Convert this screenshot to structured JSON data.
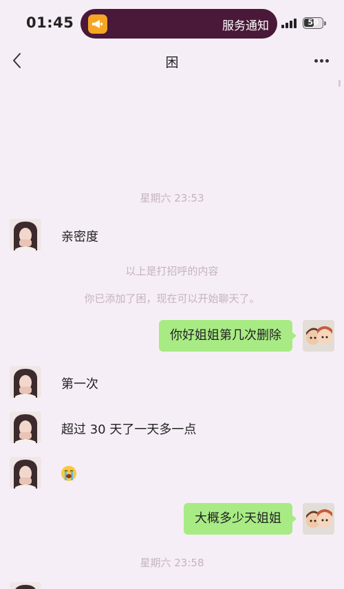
{
  "status_bar": {
    "time": "01:45",
    "notification_text": "服务通知",
    "battery_level": "50",
    "island_color": "#4a1838",
    "app_icon": "megaphone-icon"
  },
  "header": {
    "title": "困",
    "back_icon": "chevron-left-icon",
    "more_icon": "more-dots-icon"
  },
  "chat": {
    "timestamp_1": "星期六 23:53",
    "messages": [
      {
        "side": "left",
        "text": "亲密度"
      },
      {
        "side": "system",
        "text": "以上是打招呼的内容"
      },
      {
        "side": "system",
        "text": "你已添加了困，现在可以开始聊天了。"
      },
      {
        "side": "right",
        "text": "你好姐姐第几次删除"
      },
      {
        "side": "left",
        "text": "第一次"
      },
      {
        "side": "left",
        "text": "超过 30 天了一天多一点"
      },
      {
        "side": "left",
        "emoji": "loudly-crying-face-icon"
      },
      {
        "side": "right",
        "text": "大概多少天姐姐"
      }
    ],
    "timestamp_2": "星期六 23:58",
    "bubble_color": "#a8eb84"
  }
}
